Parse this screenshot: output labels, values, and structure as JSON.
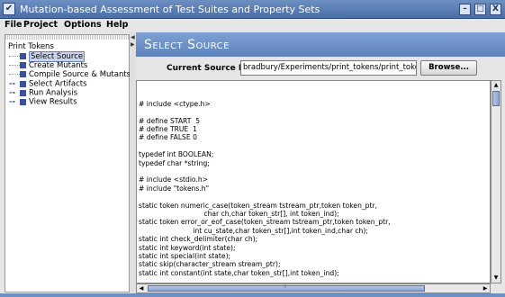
{
  "window": {
    "title": "Mutation-based Assessment of Test Suites and Property Sets",
    "minimize": "–",
    "maximize": "□",
    "close": "X"
  },
  "menu": [
    {
      "label": "File"
    },
    {
      "label": "Project"
    },
    {
      "label": "Options"
    },
    {
      "label": "Help"
    }
  ],
  "tree": {
    "root": "Print Tokens",
    "items": [
      {
        "label": "Select Source",
        "selected": true,
        "expandable": false
      },
      {
        "label": "Create Mutants",
        "selected": false,
        "expandable": false
      },
      {
        "label": "Compile Source & Mutants",
        "selected": false,
        "expandable": false
      },
      {
        "label": "Select Artifacts",
        "selected": false,
        "expandable": true
      },
      {
        "label": "Run Analysis",
        "selected": false,
        "expandable": true
      },
      {
        "label": "View Results",
        "selected": false,
        "expandable": true
      }
    ]
  },
  "panel": {
    "title": "Select Source",
    "source_label": "Current Source File:",
    "source_value": "bradbury/Experiments/print_tokens/print_tokens.c",
    "browse_label": "Browse..."
  },
  "code": [
    "",
    "",
    "# include <ctype.h>",
    "",
    "# define START  5",
    "# define TRUE  1",
    "# define FALSE 0",
    "",
    "typedef int BOOLEAN;",
    "typedef char *string;",
    "",
    "# include <stdio.h>",
    "# include \"tokens.h\"",
    "",
    "static token numeric_case(token_stream tstream_ptr,token token_ptr,",
    "                              char ch,char token_str[], int token_ind);",
    "static token error_or_eof_case(token_stream tstream_ptr,token token_ptr,",
    "                         int cu_state,char token_str[],int token_ind,char ch);",
    "static int check_delimiter(char ch);",
    "static int keyword(int state);",
    "static int special(int state);",
    "static skip(character_stream stream_ptr);",
    "static int constant(int state,char token_str[],int token_ind);"
  ],
  "colors": {
    "titlebar": "#5a7db5",
    "header": "#6e91c8",
    "tree_icon": "#3b4f9a"
  }
}
